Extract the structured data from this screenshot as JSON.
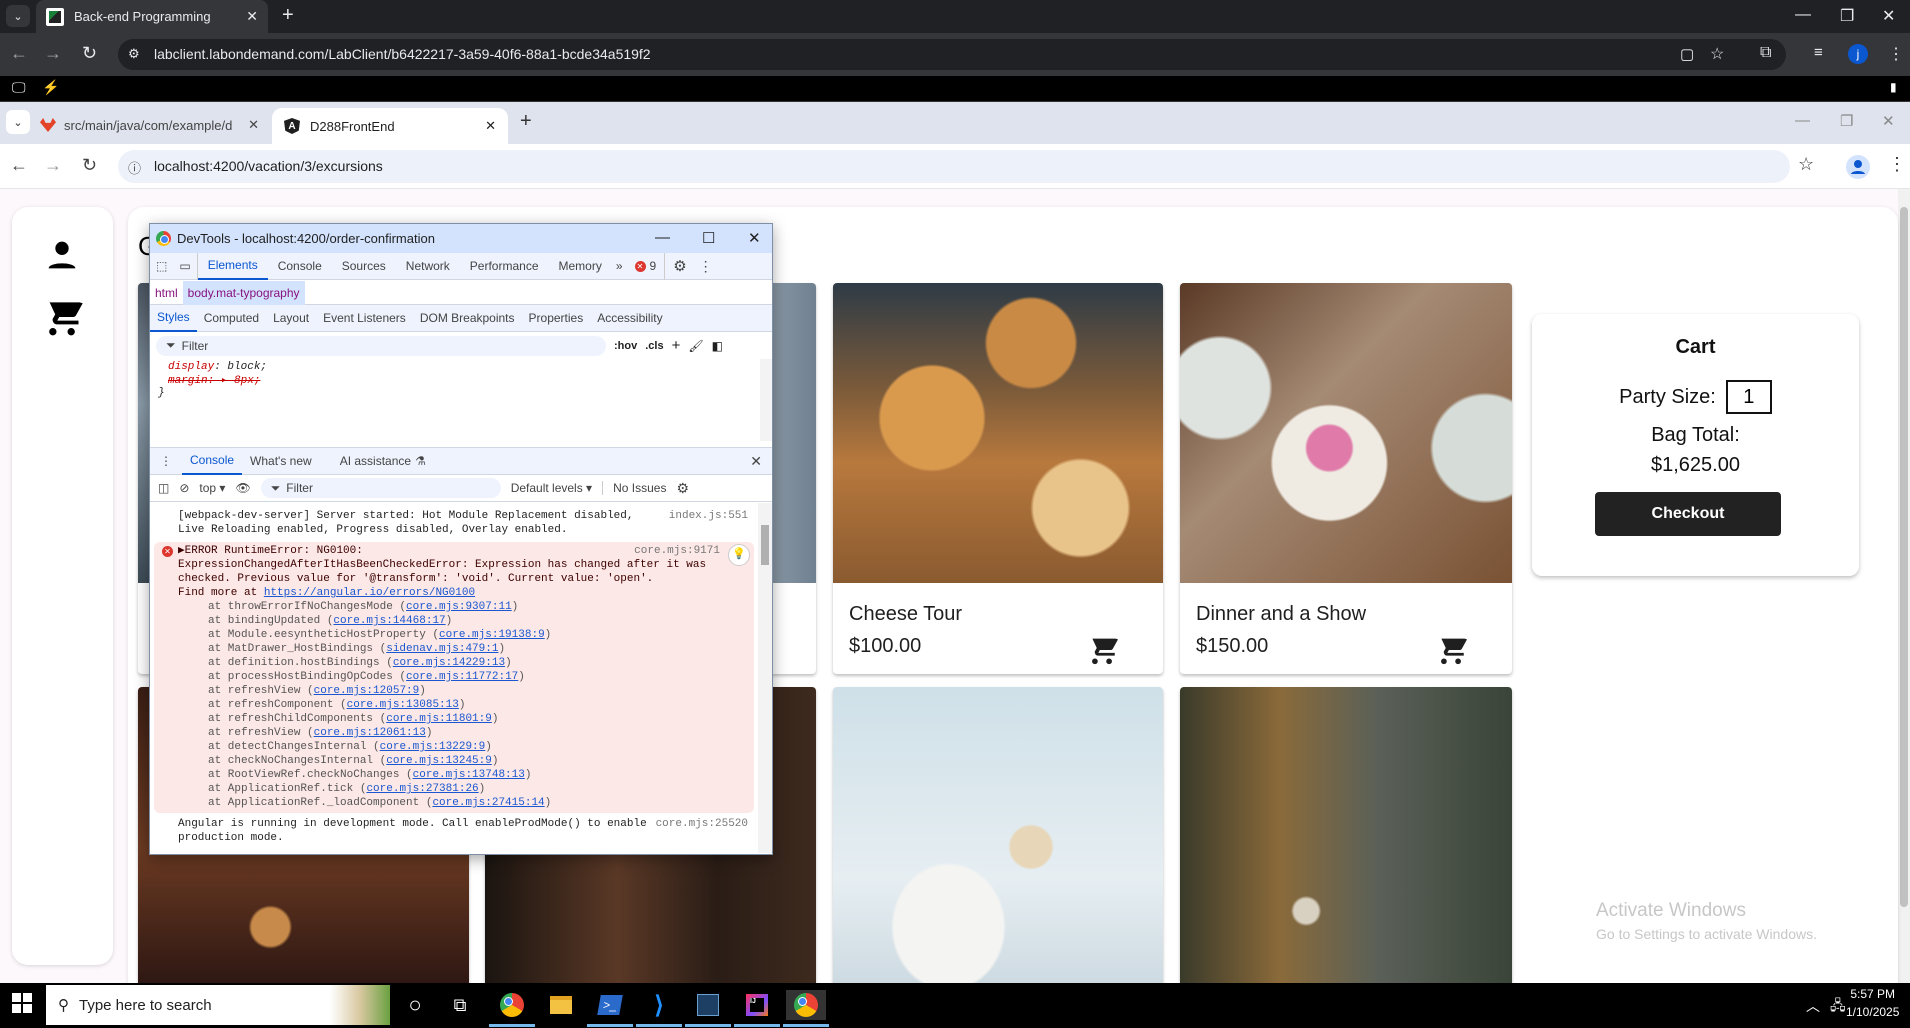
{
  "outer_browser": {
    "tab_title": "Back-end Programming",
    "url": "labclient.labondemand.com/LabClient/b6422217-3a59-40f6-88a1-bcde34a519f2"
  },
  "inner_browser": {
    "tabs": [
      {
        "title": "src/main/java/com/example/d",
        "icon": "gitlab-icon",
        "active": false
      },
      {
        "title": "D288FrontEnd",
        "icon": "angular-icon",
        "active": true
      }
    ],
    "url": "localhost:4200/vacation/3/excursions"
  },
  "page": {
    "heading_partial": "G",
    "excursions": [
      {
        "title": "Cheese Tour",
        "price": "$100.00",
        "image": "cheese"
      },
      {
        "title": "Dinner and a Show",
        "price": "$150.00",
        "image": "dinner"
      }
    ],
    "cart": {
      "title": "Cart",
      "party_size_label": "Party Size:",
      "party_size_value": "1",
      "bag_total_label": "Bag Total:",
      "bag_total_value": "$1,625.00",
      "checkout_label": "Checkout"
    },
    "watermark": {
      "line1": "Activate Windows",
      "line2": "Go to Settings to activate Windows."
    }
  },
  "devtools": {
    "window_title": "DevTools - localhost:4200/order-confirmation",
    "tabs": [
      "Elements",
      "Console",
      "Sources",
      "Network",
      "Performance",
      "Memory"
    ],
    "active_tab": "Elements",
    "more_tabs": "»",
    "error_count": "9",
    "breadcrumbs": [
      "html",
      "body.mat-typography"
    ],
    "sub_tabs": [
      "Styles",
      "Computed",
      "Layout",
      "Event Listeners",
      "DOM Breakpoints",
      "Properties",
      "Accessibility"
    ],
    "filter_placeholder": "Filter",
    "hov": ":hov",
    "cls": ".cls",
    "styles": {
      "line1_prop": "display",
      "line1_val": "block;",
      "line2_prop": "margin",
      "line2_val": "8px;",
      "close": "}"
    },
    "drawer_tabs": [
      "Console",
      "What's new",
      "AI assistance"
    ],
    "console_toolbar": {
      "context": "top ▾",
      "filter_placeholder": "Filter",
      "levels": "Default levels ▾",
      "issues": "No Issues"
    },
    "messages": {
      "webpack": {
        "text": "[webpack-dev-server] Server started: Hot Module Replacement disabled, Live Reloading enabled, Progress disabled, Overlay enabled.",
        "source": "index.js:551"
      },
      "error": {
        "head": "▶ERROR RuntimeError: NG0100:",
        "source": "core.mjs:9171",
        "body": "ExpressionChangedAfterItHasBeenCheckedError: Expression has changed after it was checked. Previous value for '@transform': 'void'. Current value: 'open'.",
        "find_more": "Find more at ",
        "link": "https://angular.io/errors/NG0100",
        "frames": [
          {
            "fn": "at throwErrorIfNoChangesMode (",
            "loc": "core.mjs:9307:11"
          },
          {
            "fn": "at bindingUpdated (",
            "loc": "core.mjs:14468:17"
          },
          {
            "fn": "at Module.eesyntheticHostProperty (",
            "loc": "core.mjs:19138:9"
          },
          {
            "fn": "at MatDrawer_HostBindings (",
            "loc": "sidenav.mjs:479:1"
          },
          {
            "fn": "at definition.hostBindings (",
            "loc": "core.mjs:14229:13"
          },
          {
            "fn": "at processHostBindingOpCodes (",
            "loc": "core.mjs:11772:17"
          },
          {
            "fn": "at refreshView (",
            "loc": "core.mjs:12057:9"
          },
          {
            "fn": "at refreshComponent (",
            "loc": "core.mjs:13085:13"
          },
          {
            "fn": "at refreshChildComponents (",
            "loc": "core.mjs:11801:9"
          },
          {
            "fn": "at refreshView (",
            "loc": "core.mjs:12061:13"
          },
          {
            "fn": "at detectChangesInternal (",
            "loc": "core.mjs:13229:9"
          },
          {
            "fn": "at checkNoChangesInternal (",
            "loc": "core.mjs:13245:9"
          },
          {
            "fn": "at RootViewRef.checkNoChanges (",
            "loc": "core.mjs:13748:13"
          },
          {
            "fn": "at ApplicationRef.tick (",
            "loc": "core.mjs:27381:26"
          },
          {
            "fn": "at ApplicationRef._loadComponent (",
            "loc": "core.mjs:27415:14"
          }
        ]
      },
      "devmode": {
        "text": "Angular is running in development mode. Call enableProdMode() to enable production mode.",
        "source": "core.mjs:25520"
      }
    }
  },
  "taskbar": {
    "search_placeholder": "Type here to search",
    "time": "5:57 PM",
    "date": "1/10/2025",
    "apps": [
      "chrome-icon",
      "file-explorer-icon",
      "powershell-icon",
      "vscode-icon",
      "mysql-workbench-icon",
      "intellij-icon",
      "chrome-icon"
    ]
  }
}
